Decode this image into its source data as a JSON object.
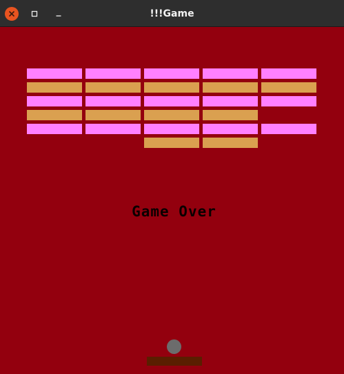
{
  "window": {
    "title": "!!!Game"
  },
  "icons": {
    "close": "close-icon",
    "maximize": "maximize-icon",
    "minimize": "minimize-icon"
  },
  "game": {
    "message": "Game Over",
    "colors": {
      "background": "#93000e",
      "brick_pink": "#ff80ff",
      "brick_orange": "#daa050",
      "ball": "#6c6c6c",
      "paddle": "#5a1e00"
    },
    "brick_rows": [
      [
        "pink",
        "pink",
        "pink",
        "pink",
        "pink"
      ],
      [
        "orange",
        "orange",
        "orange",
        "orange",
        "orange"
      ],
      [
        "pink",
        "pink",
        "pink",
        "pink",
        "pink"
      ],
      [
        "orange",
        "orange",
        "orange",
        "orange",
        null
      ],
      [
        "pink",
        "pink",
        "pink",
        "pink",
        "pink"
      ],
      [
        null,
        null,
        "orange",
        "orange",
        null
      ]
    ]
  }
}
